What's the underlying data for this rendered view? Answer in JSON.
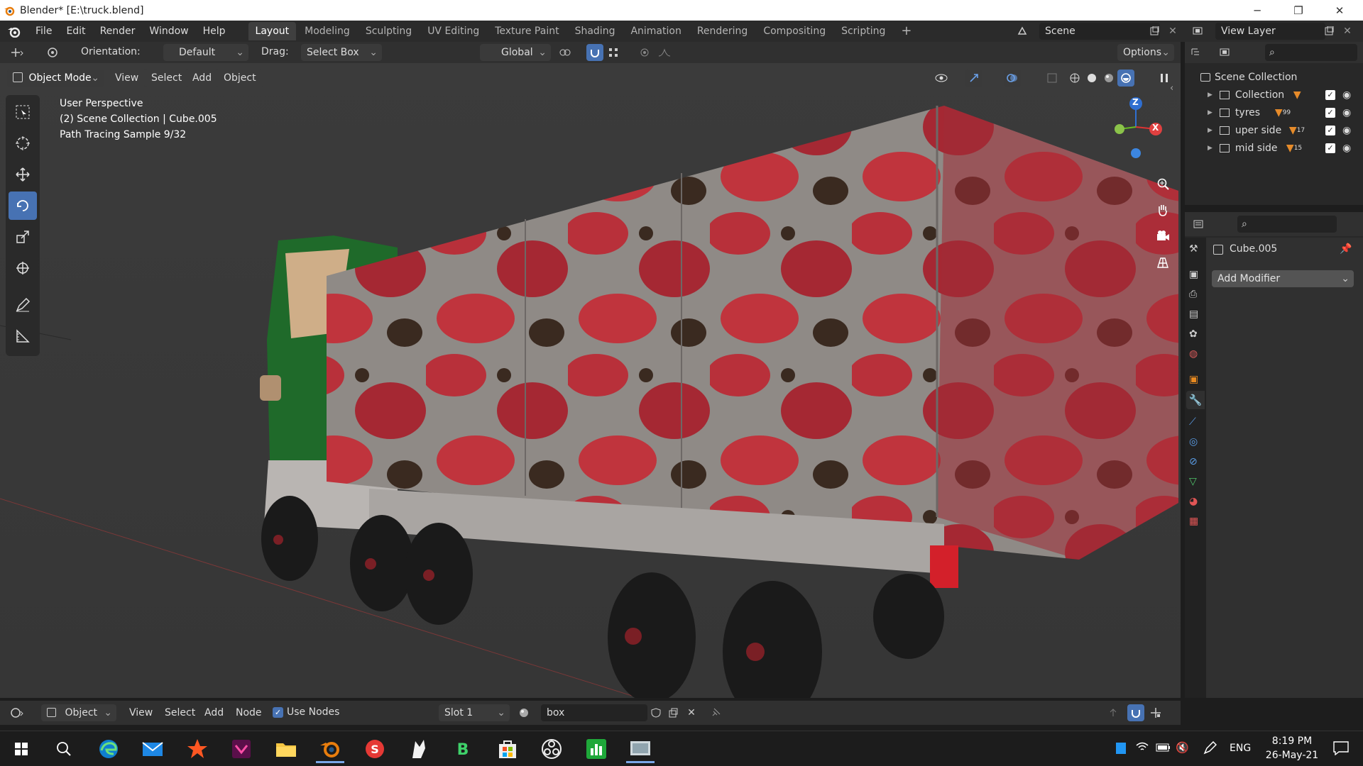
{
  "window": {
    "title": "Blender* [E:\\truck.blend]"
  },
  "topbar": {
    "menus": [
      "File",
      "Edit",
      "Render",
      "Window",
      "Help"
    ],
    "workspaces": [
      "Layout",
      "Modeling",
      "Sculpting",
      "UV Editing",
      "Texture Paint",
      "Shading",
      "Animation",
      "Rendering",
      "Compositing",
      "Scripting"
    ],
    "active_workspace": "Layout",
    "scene": "Scene",
    "view_layer": "View Layer"
  },
  "tool_header": {
    "orientation_label": "Orientation:",
    "orientation_value": "Default",
    "drag_label": "Drag:",
    "drag_value": "Select Box",
    "transform_orientation": "Global",
    "options": "Options"
  },
  "viewport_header": {
    "mode": "Object Mode",
    "menus": [
      "View",
      "Select",
      "Add",
      "Object"
    ]
  },
  "viewport": {
    "perspective": "User Perspective",
    "collection_info": "(2) Scene Collection | Cube.005",
    "render_status": "Path Tracing Sample 9/32",
    "gizmo": {
      "z": "Z",
      "x": "X"
    }
  },
  "outliner": {
    "root": "Scene Collection",
    "items": [
      {
        "name": "Collection",
        "badge": ""
      },
      {
        "name": "tyres",
        "badge": "99"
      },
      {
        "name": "uper side",
        "badge": "17"
      },
      {
        "name": "mid side",
        "badge": "15"
      }
    ]
  },
  "properties": {
    "object_name": "Cube.005",
    "add_modifier": "Add Modifier"
  },
  "node_header": {
    "object_type": "Object",
    "menus": [
      "View",
      "Select",
      "Add",
      "Node"
    ],
    "use_nodes_label": "Use Nodes",
    "use_nodes_checked": true,
    "slot": "Slot 1",
    "material": "box"
  },
  "taskbar": {
    "language": "ENG",
    "time": "8:19 PM",
    "date": "26-May-21"
  },
  "colors": {
    "accent": "#4772b3",
    "header_bg": "#303030",
    "viewport_bg": "#393939",
    "panel_bg": "#282828"
  }
}
